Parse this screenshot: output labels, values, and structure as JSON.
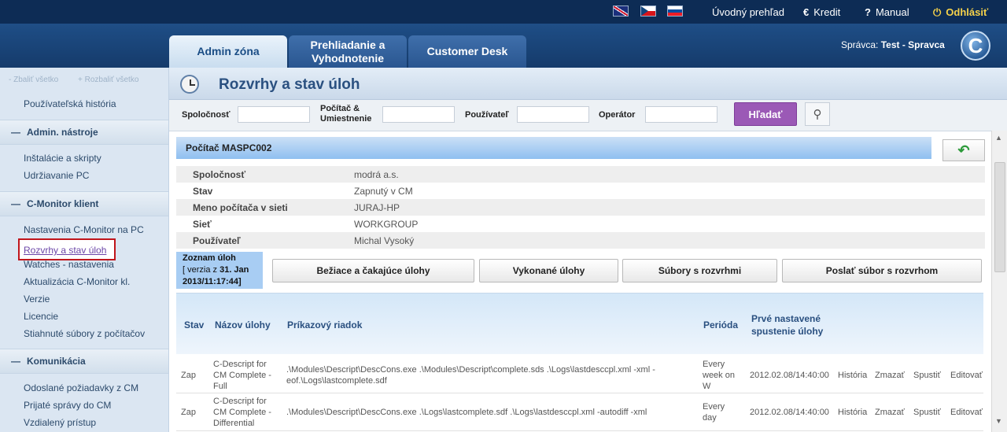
{
  "topbar": {
    "flags": [
      "uk-flag",
      "cz-flag",
      "sk-flag"
    ],
    "overview": "Úvodný prehľad",
    "credit_icon": "€",
    "credit": "Kredit",
    "manual_icon": "?",
    "manual": "Manual",
    "logout_icon": "⏻",
    "logout": "Odhlásiť"
  },
  "tabs": [
    {
      "label": "Admin zóna"
    },
    {
      "label": "Prehliadanie a Vyhodnotenie"
    },
    {
      "label": "Customer Desk"
    }
  ],
  "admin": {
    "label": "Správca:",
    "name": "Test - Spravca",
    "logo": "C"
  },
  "sidebar": {
    "collapse_all": "- Zbaliť všetko",
    "expand_all": "+ Rozbaliť všetko",
    "user_history": "Používateľská história",
    "sections": [
      {
        "title": "Admin. nástroje",
        "items": [
          "Inštalácie a skripty",
          "Udržiavanie PC"
        ]
      },
      {
        "title": "C-Monitor klient",
        "items": [
          "Nastavenia C-Monitor na PC",
          "Rozvrhy a stav úloh",
          "Watches - nastavenia",
          "Aktualizácia C-Monitor kl.",
          "Verzie",
          "Licencie",
          "Stiahnuté súbory z počítačov"
        ]
      },
      {
        "title": "Komunikácia",
        "items": [
          "Odoslané požiadavky z CM",
          "Prijaté správy do CM",
          "Vzdialený prístup"
        ]
      }
    ]
  },
  "page": {
    "title": "Rozvrhy a stav úloh"
  },
  "filters": {
    "company": "Spoločnosť",
    "computer_line1": "Počítač &",
    "computer_line2": "Umiestnenie",
    "user": "Používateľ",
    "operator": "Operátor",
    "search": "Hľadať",
    "zoom_icon": "⚲"
  },
  "computer": {
    "header": "Počítač MASPC002",
    "back_icon": "↶",
    "rows": [
      {
        "k": "Spoločnosť",
        "v": "modrá a.s."
      },
      {
        "k": "Stav",
        "v": "Zapnutý v CM"
      },
      {
        "k": "Meno počítača v sieti",
        "v": "JURAJ-HP"
      },
      {
        "k": "Sieť",
        "v": "WORKGROUP"
      },
      {
        "k": "Používateľ",
        "v": "Michal Vysoký"
      }
    ]
  },
  "tasklist": {
    "title": "Zoznam úloh",
    "version_prefix": "[ verzia z",
    "version_date": "31. Jan",
    "version_time": "2013/11:17:44]",
    "buttons": [
      "Bežiace a čakajúce úlohy",
      "Vykonané úlohy",
      "Súbory s rozvrhmi",
      "Poslať súbor s rozvrhom"
    ]
  },
  "table": {
    "headers": {
      "status": "Stav",
      "name": "Názov úlohy",
      "command": "Príkazový riadok",
      "period": "Perióda",
      "first_run_1": "Prvé nastavené",
      "first_run_2": "spustenie úlohy"
    },
    "rows": [
      {
        "status": "Zap",
        "name": "C-Descript for CM Complete - Full",
        "command": ".\\Modules\\Descript\\DescCons.exe .\\Modules\\Descript\\complete.sds .\\Logs\\lastdesccpl.xml -xml -eof.\\Logs\\lastcomplete.sdf",
        "period": "Every week on W",
        "first_run": "2012.02.08/14:40:00",
        "actions": [
          "História",
          "Zmazať",
          "Spustiť",
          "Editovať"
        ]
      },
      {
        "status": "Zap",
        "name": "C-Descript for CM Complete - Differential",
        "command": ".\\Modules\\Descript\\DescCons.exe .\\Logs\\lastcomplete.sdf .\\Logs\\lastdesccpl.xml -autodiff -xml",
        "period": "Every day",
        "first_run": "2012.02.08/14:40:00",
        "actions": [
          "História",
          "Zmazať",
          "Spustiť",
          "Editovať"
        ]
      }
    ]
  }
}
